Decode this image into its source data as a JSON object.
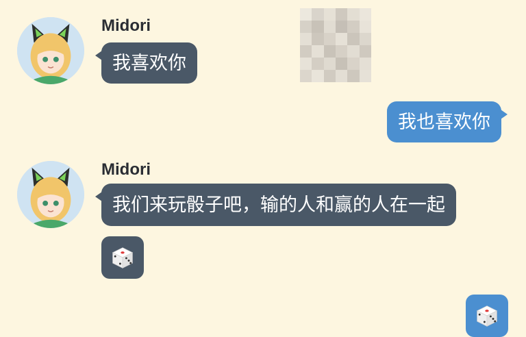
{
  "messages": [
    {
      "sender": "Midori",
      "text": "我喜欢你",
      "direction": "incoming"
    },
    {
      "text": "我也喜欢你",
      "direction": "outgoing"
    },
    {
      "sender": "Midori",
      "text": "我们来玩骰子吧，输的人和赢的人在一起",
      "direction": "incoming"
    },
    {
      "sticker": "dice-icon",
      "direction": "incoming"
    },
    {
      "sticker": "dice-icon",
      "direction": "outgoing"
    }
  ],
  "colors": {
    "background": "#fdf6e0",
    "incoming_bubble": "#4a5867",
    "outgoing_bubble": "#4b8fd0",
    "sender_name": "#2a2d33"
  }
}
